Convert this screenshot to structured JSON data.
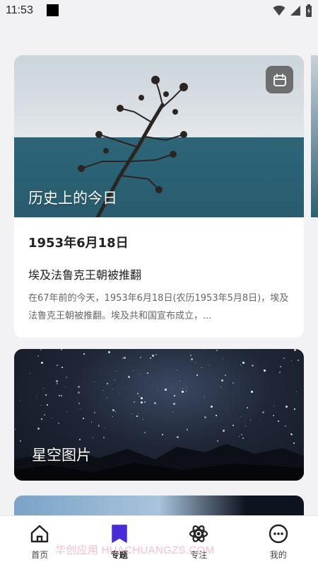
{
  "status_bar": {
    "time": "11:53",
    "icons": [
      "notification-square",
      "wifi-icon",
      "signal-icon",
      "battery-icon"
    ]
  },
  "card_history": {
    "hero_title": "历史上的今日",
    "date": "1953年6月18日",
    "event_title": "埃及法鲁克王朝被推翻",
    "description": "在67年前的今天，1953年6月18日(农历1953年5月8日)，埃及法鲁克王朝被推翻。埃及共和国宣布成立，...",
    "calendar_icon": "calendar-icon"
  },
  "card_starry": {
    "title": "星空图片"
  },
  "tabbar": {
    "items": [
      {
        "label": "首页",
        "icon": "home-icon"
      },
      {
        "label": "专题",
        "icon": "topic-icon",
        "active": true
      },
      {
        "label": "专注",
        "icon": "atom-icon"
      },
      {
        "label": "我的",
        "icon": "more-icon"
      }
    ]
  },
  "watermark": "华创应用 HUACHUANGZS.COM",
  "colors": {
    "background": "#f2f2f4",
    "accent": "#4a2bd8",
    "card": "#ffffff"
  }
}
